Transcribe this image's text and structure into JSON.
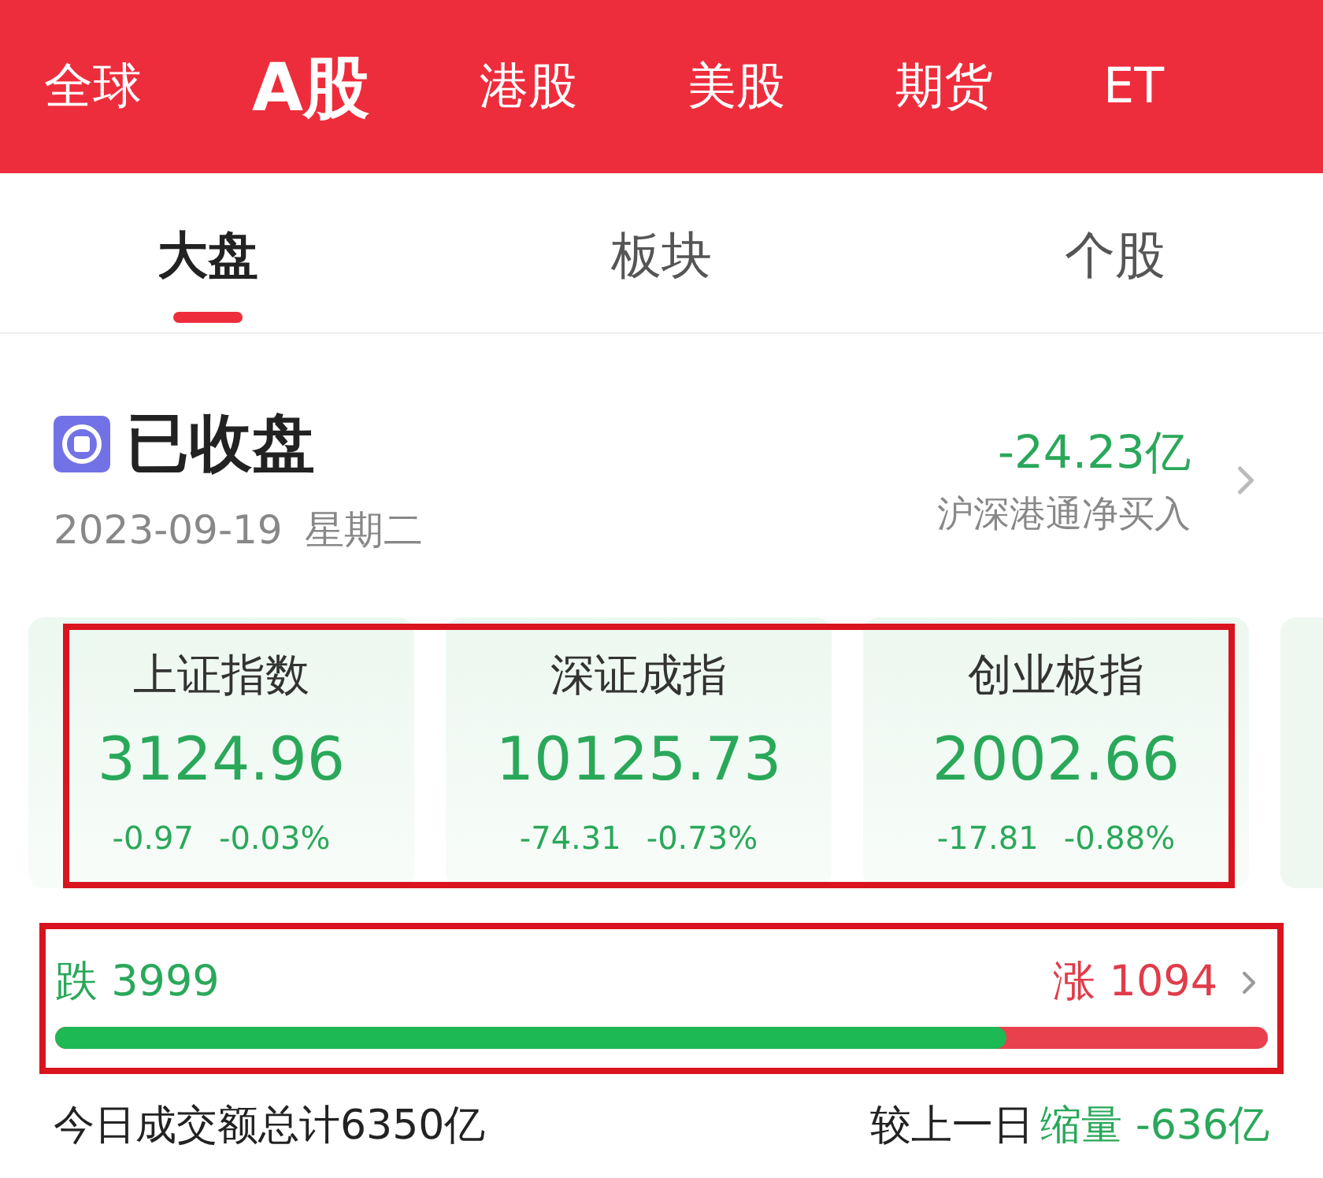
{
  "market_tabs": [
    {
      "label": "全球",
      "selected": false
    },
    {
      "label": "A股",
      "selected": true
    },
    {
      "label": "港股",
      "selected": false
    },
    {
      "label": "美股",
      "selected": false
    },
    {
      "label": "期货",
      "selected": false
    },
    {
      "label": "ET",
      "selected": false
    }
  ],
  "sub_tabs": [
    {
      "label": "大盘",
      "selected": true
    },
    {
      "label": "板块",
      "selected": false
    },
    {
      "label": "个股",
      "selected": false
    }
  ],
  "status": {
    "title": "已收盘",
    "date": "2023-09-19",
    "weekday": "星期二",
    "net_buy_value": "-24.23亿",
    "net_buy_label": "沪深港通净买入"
  },
  "indices": [
    {
      "name": "上证指数",
      "value": "3124.96",
      "change": "-0.97",
      "change_pct": "-0.03%"
    },
    {
      "name": "深证成指",
      "value": "10125.73",
      "change": "-74.31",
      "change_pct": "-0.73%"
    },
    {
      "name": "创业板指",
      "value": "2002.66",
      "change": "-17.81",
      "change_pct": "-0.88%"
    }
  ],
  "breadth": {
    "down_label": "跌",
    "down_count": "3999",
    "up_label": "涨",
    "up_count": "1094",
    "level": 0.785
  },
  "turnover": {
    "total": "今日成交额总计6350亿",
    "compare_label": "较上一日",
    "change_label": "缩量",
    "change_value": "-636亿"
  }
}
